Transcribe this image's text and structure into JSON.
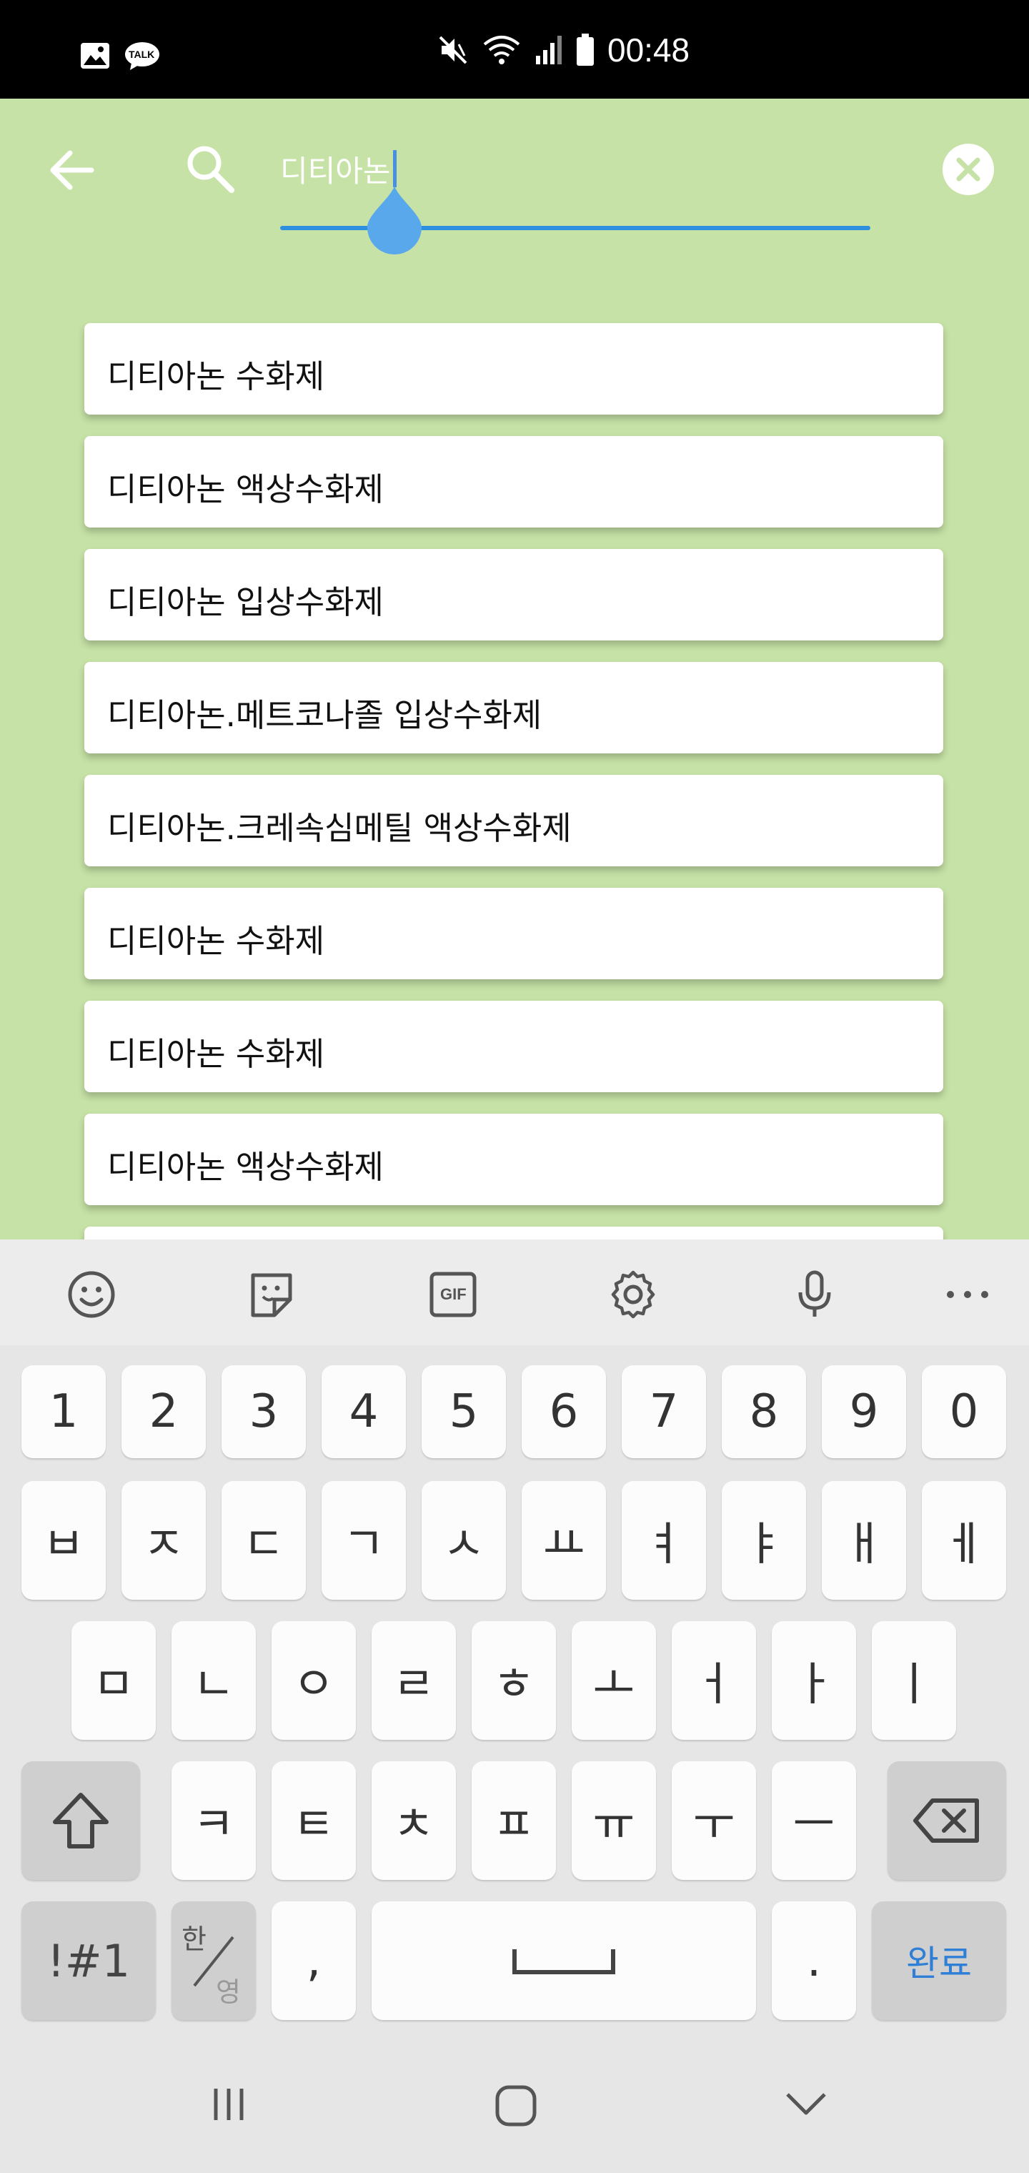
{
  "status_bar": {
    "time": "00:48",
    "icons": [
      "gallery-icon",
      "kakaotalk-icon",
      "mute-icon",
      "wifi-icon",
      "signal-icon",
      "battery-icon"
    ],
    "talk_label": "TALK"
  },
  "search": {
    "query": "디티아논"
  },
  "suggestions": [
    "디티아논 수화제",
    "디티아논 액상수화제",
    "디티아논 입상수화제",
    "디티아논.메트코나졸 입상수화제",
    "디티아논.크레속심메틸 액상수화제",
    "디티아논 수화제",
    "디티아논 수화제",
    "디티아논 액상수화제"
  ],
  "keyboard": {
    "toolbar": [
      "emoji-icon",
      "sticker-icon",
      "gif-icon",
      "settings-icon",
      "microphone-icon",
      "more-icon"
    ],
    "gif_label": "GIF",
    "row_numbers": [
      "1",
      "2",
      "3",
      "4",
      "5",
      "6",
      "7",
      "8",
      "9",
      "0"
    ],
    "row1": [
      "ㅂ",
      "ㅈ",
      "ㄷ",
      "ㄱ",
      "ㅅ",
      "ㅛ",
      "ㅕ",
      "ㅑ",
      "ㅐ",
      "ㅔ"
    ],
    "row2": [
      "ㅁ",
      "ㄴ",
      "ㅇ",
      "ㄹ",
      "ㅎ",
      "ㅗ",
      "ㅓ",
      "ㅏ",
      "ㅣ"
    ],
    "row3": [
      "ㅋ",
      "ㅌ",
      "ㅊ",
      "ㅍ",
      "ㅠ",
      "ㅜ",
      "ㅡ"
    ],
    "symbols_label": "!#1",
    "lang_top": "한",
    "lang_bottom": "영",
    "comma": ",",
    "period": ".",
    "done_label": "완료"
  },
  "colors": {
    "background": "#c6e2a6",
    "accent": "#2f8fdf",
    "done_text": "#2f7fd6"
  }
}
